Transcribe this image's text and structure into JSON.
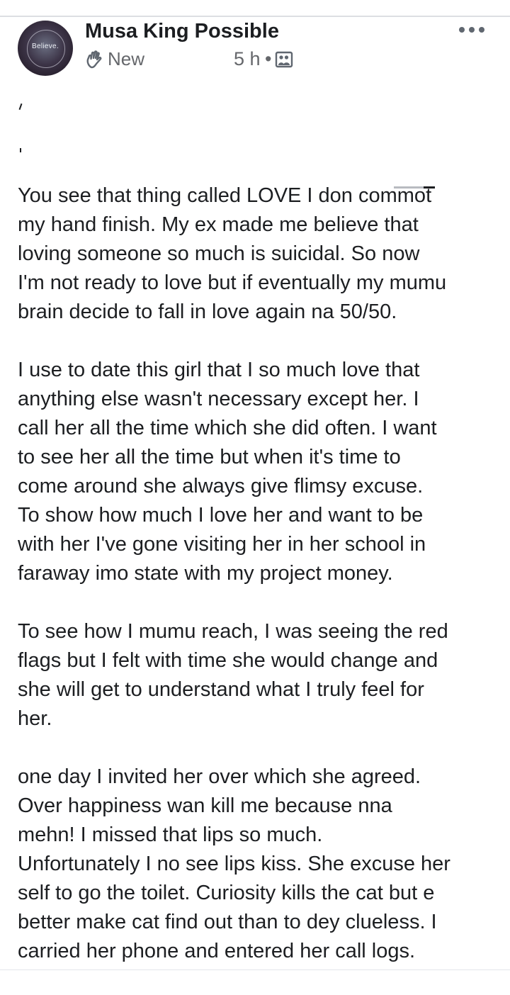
{
  "post": {
    "author": "Musa King Possible",
    "avatar_text": "Believe.",
    "group_label": "New",
    "time": "5 h",
    "separator": "•",
    "audience_icon": "photo-frame-icon",
    "badge_icon": "waving-hand-icon",
    "more_icon": "more-horizontal-icon",
    "paragraphs": [
      "You see that thing called LOVE I don commot\nmy hand finish. My ex made me believe that\nloving someone so much is suicidal. So now\nI'm not ready to love but if eventually my mumu\nbrain decide to fall in love again na 50/50.",
      "I use to date this girl that I so much love that\nanything else wasn't necessary except her. I\ncall her all the time which she did often. I want\nto see her all the time but when it's time to\ncome around she always give flimsy excuse.\nTo show how much I love her and want to be\nwith her I've gone visiting her in her school in\nfaraway imo state with my project money.",
      "To see how I mumu reach, I was seeing the red\nflags but I felt with time she would change and\nshe will get to understand what I truly feel for\nher.",
      " one day I invited her over which she agreed.\nOver happiness wan kill me because nna\nmehn! I missed that lips so much.\nUnfortunately I no see lips kiss. She excuse her\nself to go the toilet. Curiosity kills the cat but e\nbetter make cat find out than to dey clueless. I\ncarried her phone and entered her call logs."
    ]
  },
  "colors": {
    "text": "#1c1e21",
    "meta": "#65676b",
    "divider": "#dddfe2",
    "icon": "#606770"
  }
}
